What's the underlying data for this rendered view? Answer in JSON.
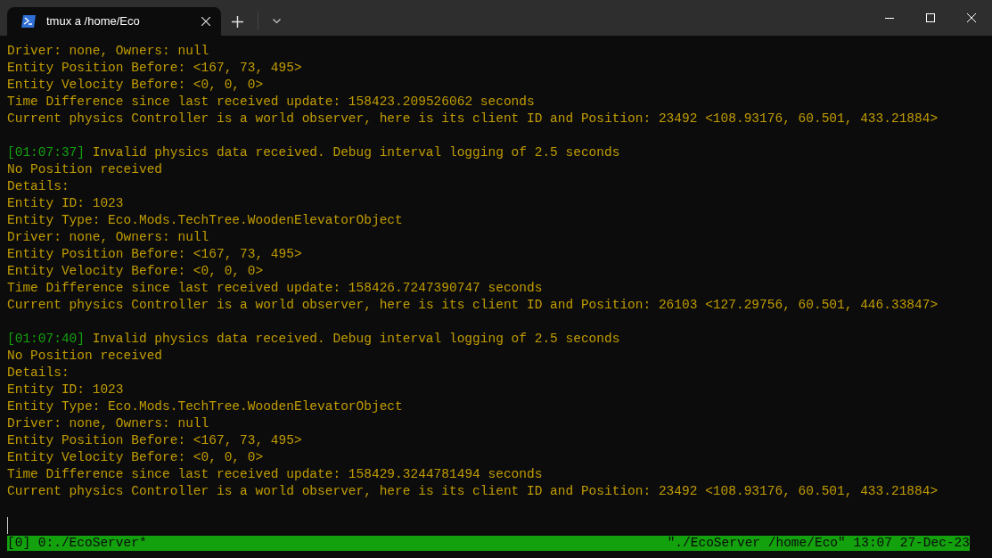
{
  "tab": {
    "title": "tmux a /home/Eco",
    "selected": true
  },
  "lines": [
    {
      "kind": "text",
      "text": "Driver: none, Owners: null"
    },
    {
      "kind": "text",
      "text": "Entity Position Before: <167, 73, 495>"
    },
    {
      "kind": "text",
      "text": "Entity Velocity Before: <0, 0, 0>"
    },
    {
      "kind": "text",
      "text": "Time Difference since last received update: 158423.209526062 seconds"
    },
    {
      "kind": "text",
      "text": "Current physics Controller is a world observer, here is its client ID and Position: 23492 <108.93176, 60.501, 433.21884>"
    },
    {
      "kind": "blank"
    },
    {
      "kind": "entry",
      "timestamp": "[01:07:37]",
      "text": "Invalid physics data received. Debug interval logging of 2.5 seconds"
    },
    {
      "kind": "text",
      "text": "No Position received"
    },
    {
      "kind": "text",
      "text": "Details:"
    },
    {
      "kind": "text",
      "text": "Entity ID: 1023"
    },
    {
      "kind": "text",
      "text": "Entity Type: Eco.Mods.TechTree.WoodenElevatorObject"
    },
    {
      "kind": "text",
      "text": "Driver: none, Owners: null"
    },
    {
      "kind": "text",
      "text": "Entity Position Before: <167, 73, 495>"
    },
    {
      "kind": "text",
      "text": "Entity Velocity Before: <0, 0, 0>"
    },
    {
      "kind": "text",
      "text": "Time Difference since last received update: 158426.7247390747 seconds"
    },
    {
      "kind": "text",
      "text": "Current physics Controller is a world observer, here is its client ID and Position: 26103 <127.29756, 60.501, 446.33847>"
    },
    {
      "kind": "blank"
    },
    {
      "kind": "entry",
      "timestamp": "[01:07:40]",
      "text": "Invalid physics data received. Debug interval logging of 2.5 seconds"
    },
    {
      "kind": "text",
      "text": "No Position received"
    },
    {
      "kind": "text",
      "text": "Details:"
    },
    {
      "kind": "text",
      "text": "Entity ID: 1023"
    },
    {
      "kind": "text",
      "text": "Entity Type: Eco.Mods.TechTree.WoodenElevatorObject"
    },
    {
      "kind": "text",
      "text": "Driver: none, Owners: null"
    },
    {
      "kind": "text",
      "text": "Entity Position Before: <167, 73, 495>"
    },
    {
      "kind": "text",
      "text": "Entity Velocity Before: <0, 0, 0>"
    },
    {
      "kind": "text",
      "text": "Time Difference since last received update: 158429.3244781494 seconds"
    },
    {
      "kind": "text",
      "text": "Current physics Controller is a world observer, here is its client ID and Position: 23492 <108.93176, 60.501, 433.21884>"
    },
    {
      "kind": "blank"
    }
  ],
  "status_bar": {
    "left": "[0] 0:./EcoServer*",
    "right": "\"./EcoServer /home/Eco\" 13:07 27-Dec-23"
  }
}
